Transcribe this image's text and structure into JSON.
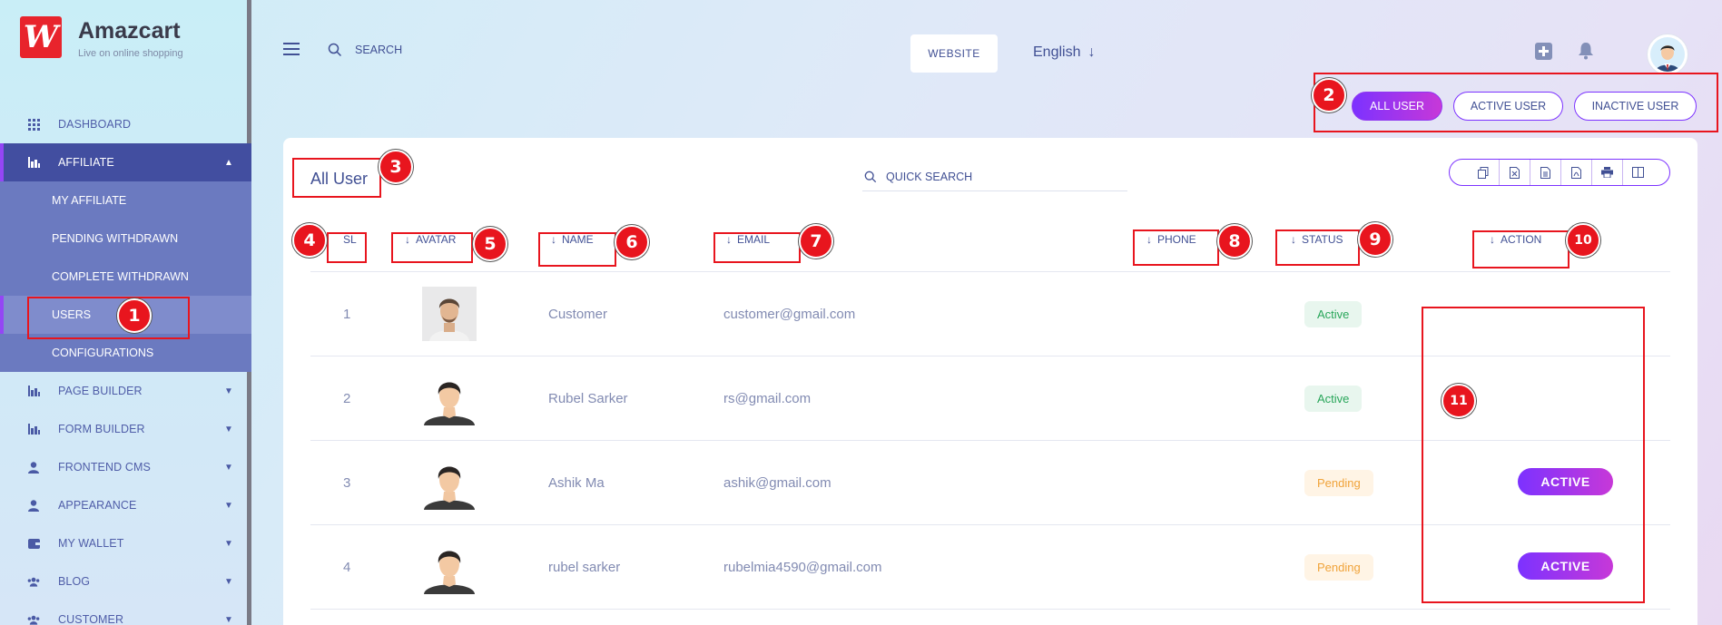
{
  "brand": {
    "logo_letter": "W",
    "name": "Amazcart",
    "tagline": "Live on online shopping"
  },
  "sidebar": {
    "items": [
      {
        "label": "DASHBOARD",
        "icon": "grid-icon",
        "expandable": false
      },
      {
        "label": "AFFILIATE",
        "icon": "bar-chart-icon",
        "expandable": true,
        "expanded": true
      },
      {
        "label": "PAGE BUILDER",
        "icon": "bar-chart-icon",
        "expandable": true
      },
      {
        "label": "FORM BUILDER",
        "icon": "bar-chart-icon",
        "expandable": true
      },
      {
        "label": "FRONTEND CMS",
        "icon": "user-icon",
        "expandable": true
      },
      {
        "label": "APPEARANCE",
        "icon": "user-icon",
        "expandable": true
      },
      {
        "label": "MY WALLET",
        "icon": "wallet-icon",
        "expandable": true
      },
      {
        "label": "BLOG",
        "icon": "users-icon",
        "expandable": true
      },
      {
        "label": "CUSTOMER",
        "icon": "users-icon",
        "expandable": true
      }
    ],
    "affiliate_submenu": [
      {
        "label": "MY AFFILIATE"
      },
      {
        "label": "PENDING WITHDRAWN"
      },
      {
        "label": "COMPLETE WITHDRAWN"
      },
      {
        "label": "USERS",
        "current": true
      },
      {
        "label": "CONFIGURATIONS"
      }
    ]
  },
  "header": {
    "search_label": "SEARCH",
    "website_button": "WEBSITE",
    "language": "English"
  },
  "filters": {
    "all": "ALL USER",
    "active": "ACTIVE USER",
    "inactive": "INACTIVE USER"
  },
  "card": {
    "title": "All User",
    "quick_search": "QUICK SEARCH",
    "export_icons": [
      "copy-icon",
      "excel-icon",
      "csv-icon",
      "pdf-icon",
      "print-icon",
      "columns-icon"
    ]
  },
  "table": {
    "columns": [
      "SL",
      "AVATAR",
      "NAME",
      "EMAIL",
      "PHONE",
      "STATUS",
      "ACTION"
    ],
    "rows": [
      {
        "sl": "1",
        "name": "Customer",
        "email": "customer@gmail.com",
        "phone": "",
        "status": "Active",
        "status_type": "active",
        "action": ""
      },
      {
        "sl": "2",
        "name": "Rubel Sarker",
        "email": "rs@gmail.com",
        "phone": "",
        "status": "Active",
        "status_type": "active",
        "action": ""
      },
      {
        "sl": "3",
        "name": "Ashik Ma",
        "email": "ashik@gmail.com",
        "phone": "",
        "status": "Pending",
        "status_type": "pending",
        "action": "ACTIVE"
      },
      {
        "sl": "4",
        "name": "rubel sarker",
        "email": "rubelmia4590@gmail.com",
        "phone": "",
        "status": "Pending",
        "status_type": "pending",
        "action": "ACTIVE"
      }
    ]
  },
  "annotations": [
    "1",
    "2",
    "3",
    "4",
    "5",
    "6",
    "7",
    "8",
    "9",
    "10",
    "11"
  ],
  "colors": {
    "accent_purple": "#7c32ff",
    "nav_active": "#424ea0",
    "annotation_red": "#e8151e",
    "status_active": "#29a65a",
    "status_pending": "#f0a33a"
  }
}
